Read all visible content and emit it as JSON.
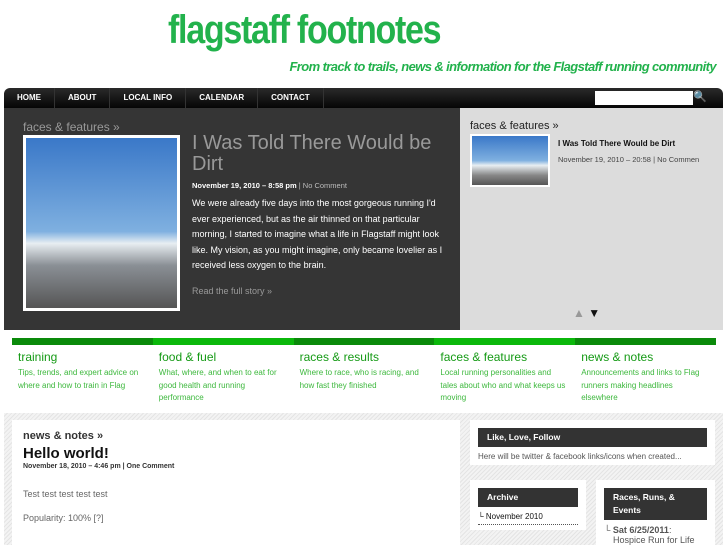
{
  "site": {
    "title": "flagstaff footnotes",
    "tagline": "From track to trails, news & information for the Flagstaff running community"
  },
  "nav": [
    "HOME",
    "ABOUT",
    "LOCAL INFO",
    "CALENDAR",
    "CONTACT"
  ],
  "search": {
    "icon": "search-icon",
    "symbol": "🔍"
  },
  "featured": {
    "category": "faces & features »",
    "title": "I Was Told There Would be Dirt",
    "date": "November 19, 2010 – 8:58 pm",
    "comments": "No Comment",
    "separator": "|",
    "body": "We were already five days into the most gorgeous running I'd ever experienced, but as the air thinned on that particular morning, I started to imagine what a life in Flagstaff might look like. My vision, as you might imagine, only became lovelier as I received less oxygen to the brain.",
    "more": "Read the full story »"
  },
  "slider": {
    "category": "faces & features »",
    "title": "I Was Told There Would be Dirt",
    "meta": "November 19, 2010 – 20:58 | No Commen",
    "up": "▲",
    "down": "▼"
  },
  "categories": [
    {
      "title": "training",
      "desc": "Tips, trends, and expert advice on where and how to train in Flag"
    },
    {
      "title": "food & fuel",
      "desc": "What, where, and when to eat for good health and running performance"
    },
    {
      "title": "races & results",
      "desc": "Where to race, who is racing, and how fast they finished"
    },
    {
      "title": "faces & features",
      "desc": "Local running personalities and tales about who and what keeps us moving"
    },
    {
      "title": "news & notes",
      "desc": "Announcements and links to Flag runners making headlines elsewhere"
    }
  ],
  "post": {
    "category": "news & notes »",
    "title": "Hello world!",
    "date": "November 18, 2010 – 4:46 pm",
    "comments": "One Comment",
    "separator": "|",
    "body": "Test test test test test",
    "popularity": "Popularity: 100% [?]"
  },
  "widgets": {
    "like": {
      "title": "Like, Love, Follow",
      "text": "Here will be twitter & facebook links/icons when created..."
    },
    "archive": {
      "title": "Archive",
      "item": "November 2010"
    },
    "races": {
      "title": "Races, Runs, & Events",
      "date": "Sat 6/25/2011",
      "event": "Hospice Run for Life"
    }
  }
}
